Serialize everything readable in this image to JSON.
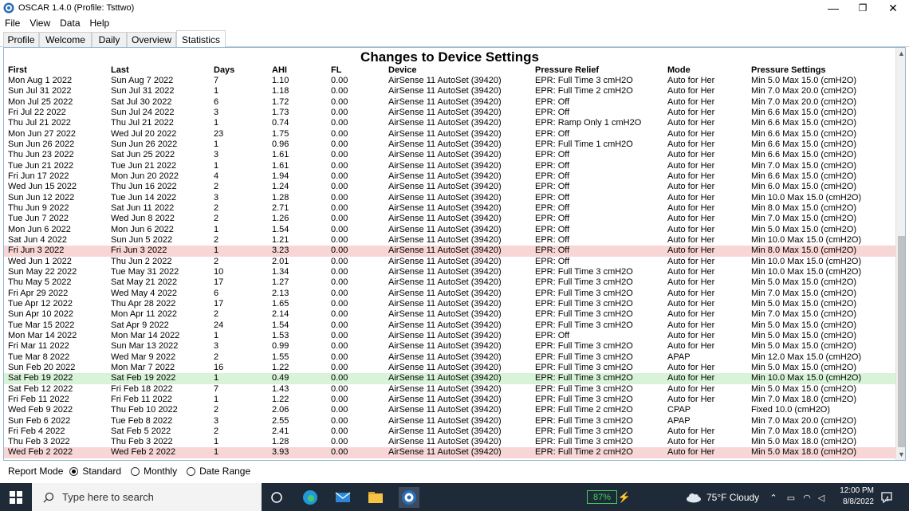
{
  "window": {
    "title": "OSCAR 1.4.0 (Profile: Tsttwo)",
    "minimize": "—",
    "maximize": "❐",
    "close": "✕"
  },
  "menu": [
    "File",
    "View",
    "Data",
    "Help"
  ],
  "tabs": [
    "Profile",
    "Welcome",
    "Daily",
    "Overview",
    "Statistics"
  ],
  "active_tab": "Statistics",
  "report": {
    "title": "Changes to Device Settings",
    "columns": [
      "First",
      "Last",
      "Days",
      "AHI",
      "FL",
      "Device",
      "Pressure Relief",
      "Mode",
      "Pressure Settings"
    ],
    "rows": [
      [
        "Mon Aug 1 2022",
        "Sun Aug 7 2022",
        "7",
        "1.10",
        "0.00",
        "AirSense 11 AutoSet (39420)",
        "EPR: Full Time 3 cmH2O",
        "Auto for Her",
        "Min 5.0 Max 15.0 (cmH2O)",
        ""
      ],
      [
        "Sun Jul 31 2022",
        "Sun Jul 31 2022",
        "1",
        "1.18",
        "0.00",
        "AirSense 11 AutoSet (39420)",
        "EPR: Full Time 2 cmH2O",
        "Auto for Her",
        "Min 7.0 Max 20.0 (cmH2O)",
        ""
      ],
      [
        "Mon Jul 25 2022",
        "Sat Jul 30 2022",
        "6",
        "1.72",
        "0.00",
        "AirSense 11 AutoSet (39420)",
        "EPR: Off",
        "Auto for Her",
        "Min 7.0 Max 20.0 (cmH2O)",
        ""
      ],
      [
        "Fri Jul 22 2022",
        "Sun Jul 24 2022",
        "3",
        "1.73",
        "0.00",
        "AirSense 11 AutoSet (39420)",
        "EPR: Off",
        "Auto for Her",
        "Min 6.6 Max 15.0 (cmH2O)",
        ""
      ],
      [
        "Thu Jul 21 2022",
        "Thu Jul 21 2022",
        "1",
        "0.74",
        "0.00",
        "AirSense 11 AutoSet (39420)",
        "EPR: Ramp Only 1 cmH2O",
        "Auto for Her",
        "Min 6.6 Max 15.0 (cmH2O)",
        ""
      ],
      [
        "Mon Jun 27 2022",
        "Wed Jul 20 2022",
        "23",
        "1.75",
        "0.00",
        "AirSense 11 AutoSet (39420)",
        "EPR: Off",
        "Auto for Her",
        "Min 6.6 Max 15.0 (cmH2O)",
        ""
      ],
      [
        "Sun Jun 26 2022",
        "Sun Jun 26 2022",
        "1",
        "0.96",
        "0.00",
        "AirSense 11 AutoSet (39420)",
        "EPR: Full Time 1 cmH2O",
        "Auto for Her",
        "Min 6.6 Max 15.0 (cmH2O)",
        ""
      ],
      [
        "Thu Jun 23 2022",
        "Sat Jun 25 2022",
        "3",
        "1.61",
        "0.00",
        "AirSense 11 AutoSet (39420)",
        "EPR: Off",
        "Auto for Her",
        "Min 6.6 Max 15.0 (cmH2O)",
        ""
      ],
      [
        "Tue Jun 21 2022",
        "Tue Jun 21 2022",
        "1",
        "1.61",
        "0.00",
        "AirSense 11 AutoSet (39420)",
        "EPR: Off",
        "Auto for Her",
        "Min 7.0 Max 15.0 (cmH2O)",
        ""
      ],
      [
        "Fri Jun 17 2022",
        "Mon Jun 20 2022",
        "4",
        "1.94",
        "0.00",
        "AirSense 11 AutoSet (39420)",
        "EPR: Off",
        "Auto for Her",
        "Min 6.6 Max 15.0 (cmH2O)",
        ""
      ],
      [
        "Wed Jun 15 2022",
        "Thu Jun 16 2022",
        "2",
        "1.24",
        "0.00",
        "AirSense 11 AutoSet (39420)",
        "EPR: Off",
        "Auto for Her",
        "Min 6.0 Max 15.0 (cmH2O)",
        ""
      ],
      [
        "Sun Jun 12 2022",
        "Tue Jun 14 2022",
        "3",
        "1.28",
        "0.00",
        "AirSense 11 AutoSet (39420)",
        "EPR: Off",
        "Auto for Her",
        "Min 10.0 Max 15.0 (cmH2O)",
        ""
      ],
      [
        "Thu Jun 9 2022",
        "Sat Jun 11 2022",
        "2",
        "2.71",
        "0.00",
        "AirSense 11 AutoSet (39420)",
        "EPR: Off",
        "Auto for Her",
        "Min 8.0 Max 15.0 (cmH2O)",
        ""
      ],
      [
        "Tue Jun 7 2022",
        "Wed Jun 8 2022",
        "2",
        "1.26",
        "0.00",
        "AirSense 11 AutoSet (39420)",
        "EPR: Off",
        "Auto for Her",
        "Min 7.0 Max 15.0 (cmH2O)",
        ""
      ],
      [
        "Mon Jun 6 2022",
        "Mon Jun 6 2022",
        "1",
        "1.54",
        "0.00",
        "AirSense 11 AutoSet (39420)",
        "EPR: Off",
        "Auto for Her",
        "Min 5.0 Max 15.0 (cmH2O)",
        ""
      ],
      [
        "Sat Jun 4 2022",
        "Sun Jun 5 2022",
        "2",
        "1.21",
        "0.00",
        "AirSense 11 AutoSet (39420)",
        "EPR: Off",
        "Auto for Her",
        "Min 10.0 Max 15.0 (cmH2O)",
        ""
      ],
      [
        "Fri Jun 3 2022",
        "Fri Jun 3 2022",
        "1",
        "3.23",
        "0.00",
        "AirSense 11 AutoSet (39420)",
        "EPR: Off",
        "Auto for Her",
        "Min 8.0 Max 15.0 (cmH2O)",
        "red"
      ],
      [
        "Wed Jun 1 2022",
        "Thu Jun 2 2022",
        "2",
        "2.01",
        "0.00",
        "AirSense 11 AutoSet (39420)",
        "EPR: Off",
        "Auto for Her",
        "Min 10.0 Max 15.0 (cmH2O)",
        ""
      ],
      [
        "Sun May 22 2022",
        "Tue May 31 2022",
        "10",
        "1.34",
        "0.00",
        "AirSense 11 AutoSet (39420)",
        "EPR: Full Time 3 cmH2O",
        "Auto for Her",
        "Min 10.0 Max 15.0 (cmH2O)",
        ""
      ],
      [
        "Thu May 5 2022",
        "Sat May 21 2022",
        "17",
        "1.27",
        "0.00",
        "AirSense 11 AutoSet (39420)",
        "EPR: Full Time 3 cmH2O",
        "Auto for Her",
        "Min 5.0 Max 15.0 (cmH2O)",
        ""
      ],
      [
        "Fri Apr 29 2022",
        "Wed May 4 2022",
        "6",
        "2.13",
        "0.00",
        "AirSense 11 AutoSet (39420)",
        "EPR: Full Time 3 cmH2O",
        "Auto for Her",
        "Min 7.0 Max 15.0 (cmH2O)",
        ""
      ],
      [
        "Tue Apr 12 2022",
        "Thu Apr 28 2022",
        "17",
        "1.65",
        "0.00",
        "AirSense 11 AutoSet (39420)",
        "EPR: Full Time 3 cmH2O",
        "Auto for Her",
        "Min 5.0 Max 15.0 (cmH2O)",
        ""
      ],
      [
        "Sun Apr 10 2022",
        "Mon Apr 11 2022",
        "2",
        "2.14",
        "0.00",
        "AirSense 11 AutoSet (39420)",
        "EPR: Full Time 3 cmH2O",
        "Auto for Her",
        "Min 7.0 Max 15.0 (cmH2O)",
        ""
      ],
      [
        "Tue Mar 15 2022",
        "Sat Apr 9 2022",
        "24",
        "1.54",
        "0.00",
        "AirSense 11 AutoSet (39420)",
        "EPR: Full Time 3 cmH2O",
        "Auto for Her",
        "Min 5.0 Max 15.0 (cmH2O)",
        ""
      ],
      [
        "Mon Mar 14 2022",
        "Mon Mar 14 2022",
        "1",
        "1.53",
        "0.00",
        "AirSense 11 AutoSet (39420)",
        "EPR: Off",
        "Auto for Her",
        "Min 5.0 Max 15.0 (cmH2O)",
        ""
      ],
      [
        "Fri Mar 11 2022",
        "Sun Mar 13 2022",
        "3",
        "0.99",
        "0.00",
        "AirSense 11 AutoSet (39420)",
        "EPR: Full Time 3 cmH2O",
        "Auto for Her",
        "Min 5.0 Max 15.0 (cmH2O)",
        ""
      ],
      [
        "Tue Mar 8 2022",
        "Wed Mar 9 2022",
        "2",
        "1.55",
        "0.00",
        "AirSense 11 AutoSet (39420)",
        "EPR: Full Time 3 cmH2O",
        "APAP",
        "Min 12.0 Max 15.0 (cmH2O)",
        ""
      ],
      [
        "Sun Feb 20 2022",
        "Mon Mar 7 2022",
        "16",
        "1.22",
        "0.00",
        "AirSense 11 AutoSet (39420)",
        "EPR: Full Time 3 cmH2O",
        "Auto for Her",
        "Min 5.0 Max 15.0 (cmH2O)",
        ""
      ],
      [
        "Sat Feb 19 2022",
        "Sat Feb 19 2022",
        "1",
        "0.49",
        "0.00",
        "AirSense 11 AutoSet (39420)",
        "EPR: Full Time 3 cmH2O",
        "Auto for Her",
        "Min 10.0 Max 15.0 (cmH2O)",
        "green"
      ],
      [
        "Sat Feb 12 2022",
        "Fri Feb 18 2022",
        "7",
        "1.43",
        "0.00",
        "AirSense 11 AutoSet (39420)",
        "EPR: Full Time 3 cmH2O",
        "Auto for Her",
        "Min 5.0 Max 15.0 (cmH2O)",
        ""
      ],
      [
        "Fri Feb 11 2022",
        "Fri Feb 11 2022",
        "1",
        "1.22",
        "0.00",
        "AirSense 11 AutoSet (39420)",
        "EPR: Full Time 3 cmH2O",
        "Auto for Her",
        "Min 7.0 Max 18.0 (cmH2O)",
        ""
      ],
      [
        "Wed Feb 9 2022",
        "Thu Feb 10 2022",
        "2",
        "2.06",
        "0.00",
        "AirSense 11 AutoSet (39420)",
        "EPR: Full Time 2 cmH2O",
        "CPAP",
        "Fixed 10.0 (cmH2O)",
        ""
      ],
      [
        "Sun Feb 6 2022",
        "Tue Feb 8 2022",
        "3",
        "2.55",
        "0.00",
        "AirSense 11 AutoSet (39420)",
        "EPR: Full Time 3 cmH2O",
        "APAP",
        "Min 7.0 Max 20.0 (cmH2O)",
        ""
      ],
      [
        "Fri Feb 4 2022",
        "Sat Feb 5 2022",
        "2",
        "2.41",
        "0.00",
        "AirSense 11 AutoSet (39420)",
        "EPR: Full Time 3 cmH2O",
        "Auto for Her",
        "Min 7.0 Max 18.0 (cmH2O)",
        ""
      ],
      [
        "Thu Feb 3 2022",
        "Thu Feb 3 2022",
        "1",
        "1.28",
        "0.00",
        "AirSense 11 AutoSet (39420)",
        "EPR: Full Time 3 cmH2O",
        "Auto for Her",
        "Min 5.0 Max 18.0 (cmH2O)",
        ""
      ],
      [
        "Wed Feb 2 2022",
        "Wed Feb 2 2022",
        "1",
        "3.93",
        "0.00",
        "AirSense 11 AutoSet (39420)",
        "EPR: Full Time 2 cmH2O",
        "Auto for Her",
        "Min 5.0 Max 18.0 (cmH2O)",
        "red"
      ]
    ]
  },
  "highlight_colors": {
    "red": "#f8d6d6",
    "green": "#d8f3d8"
  },
  "report_mode": {
    "label": "Report Mode",
    "options": [
      "Standard",
      "Monthly",
      "Date Range"
    ],
    "selected": "Standard"
  },
  "taskbar": {
    "search_placeholder": "Type here to search",
    "battery": "87%",
    "weather": "75°F  Cloudy",
    "time": "12:00 PM",
    "date": "8/8/2022",
    "notifications": "4"
  }
}
